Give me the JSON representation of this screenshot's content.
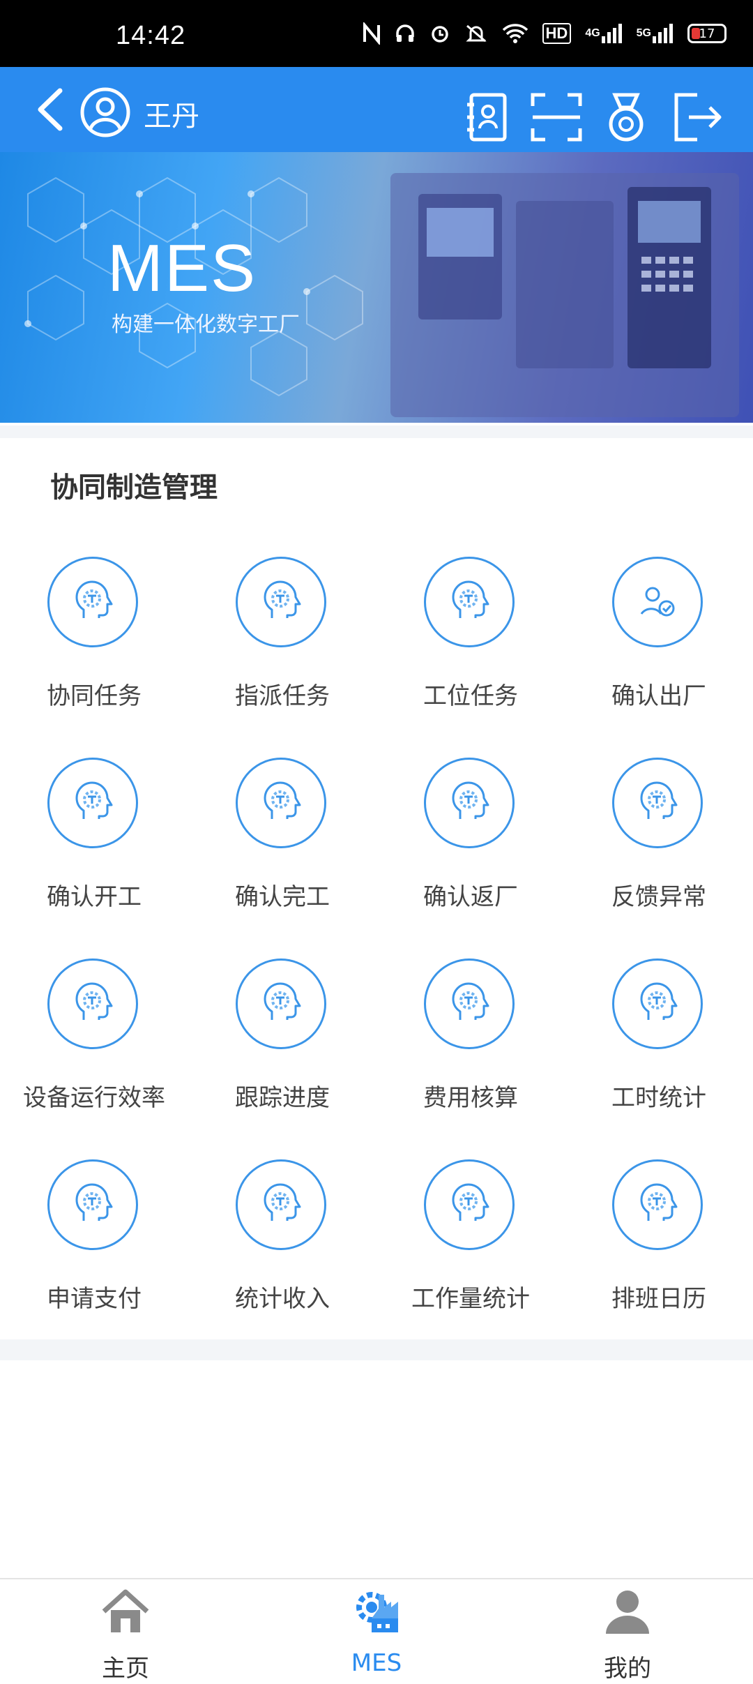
{
  "status_bar": {
    "time": "14:42",
    "net1": "4G",
    "net2": "5G",
    "hd": "HD",
    "battery": "17"
  },
  "header": {
    "user_name": "王丹"
  },
  "banner": {
    "title": "MES",
    "subtitle": "构建一体化数字工厂"
  },
  "section": {
    "title": "协同制造管理",
    "items": [
      {
        "label": "协同任务",
        "icon": "brain-gear-icon"
      },
      {
        "label": "指派任务",
        "icon": "brain-gear-icon"
      },
      {
        "label": "工位任务",
        "icon": "brain-gear-icon"
      },
      {
        "label": "确认出厂",
        "icon": "user-check-icon"
      },
      {
        "label": "确认开工",
        "icon": "brain-gear-icon"
      },
      {
        "label": "确认完工",
        "icon": "brain-gear-icon"
      },
      {
        "label": "确认返厂",
        "icon": "brain-gear-icon"
      },
      {
        "label": "反馈异常",
        "icon": "brain-gear-icon"
      },
      {
        "label": "设备运行效率",
        "icon": "brain-gear-icon"
      },
      {
        "label": "跟踪进度",
        "icon": "brain-gear-icon"
      },
      {
        "label": "费用核算",
        "icon": "brain-gear-icon"
      },
      {
        "label": "工时统计",
        "icon": "brain-gear-icon"
      },
      {
        "label": "申请支付",
        "icon": "brain-gear-icon"
      },
      {
        "label": "统计收入",
        "icon": "brain-gear-icon"
      },
      {
        "label": "工作量统计",
        "icon": "brain-gear-icon"
      },
      {
        "label": "排班日历",
        "icon": "brain-gear-icon"
      }
    ]
  },
  "tabbar": {
    "home": "主页",
    "mes": "MES",
    "mine": "我的"
  },
  "colors": {
    "accent": "#2a8bef",
    "tab_inactive": "#8a8a8a"
  }
}
